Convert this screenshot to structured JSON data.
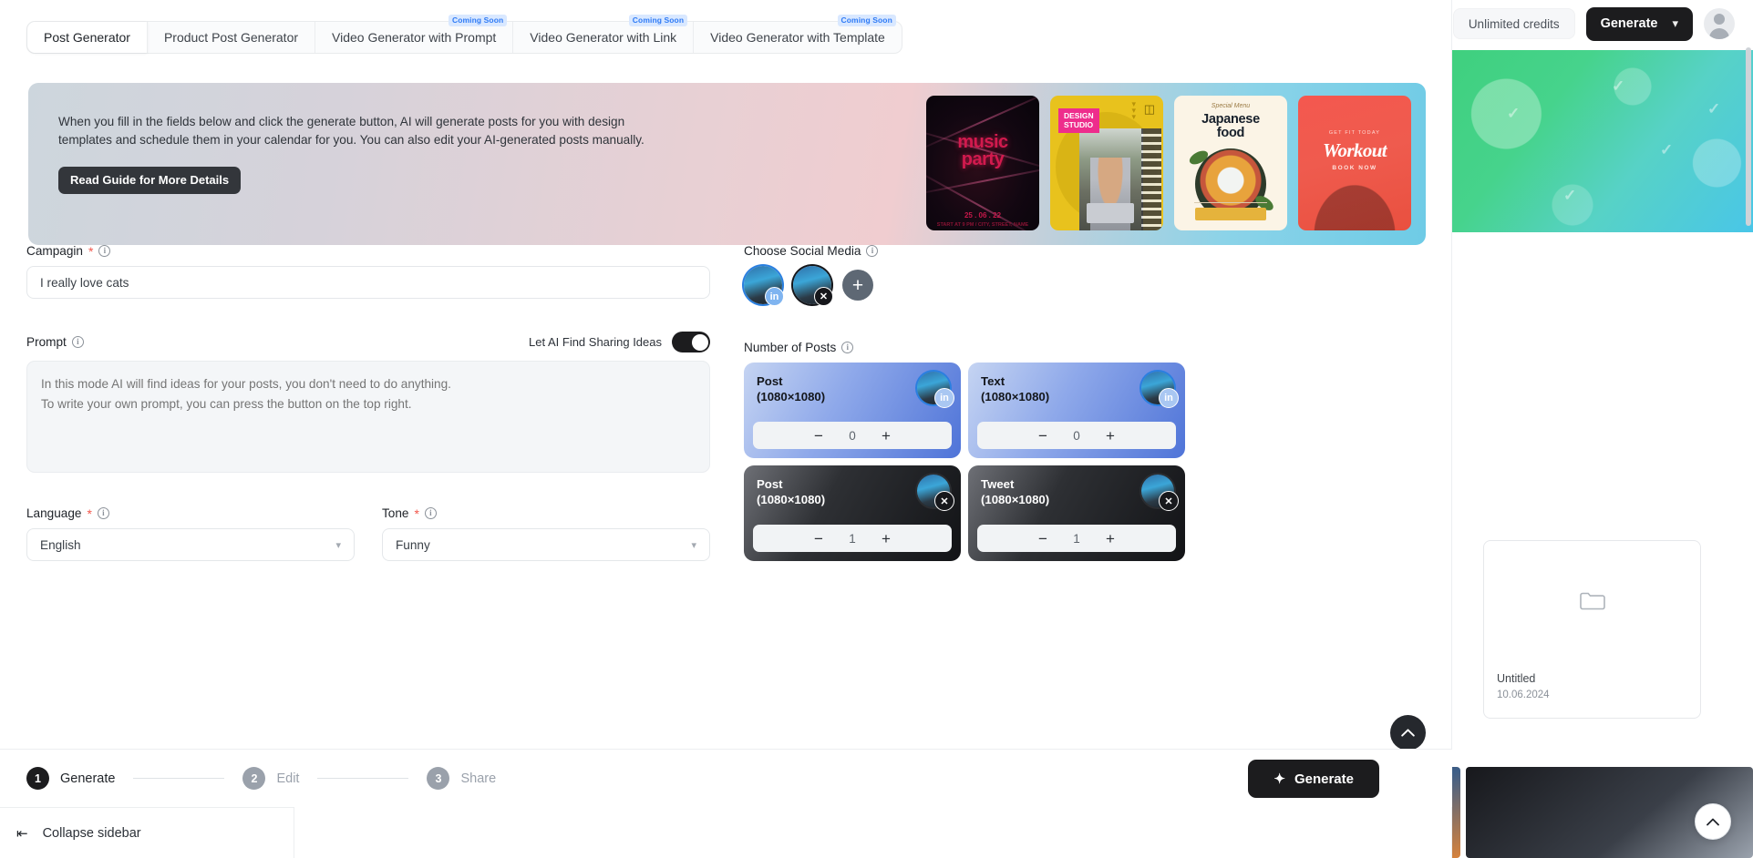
{
  "topbar": {
    "credits_label": "Unlimited credits",
    "generate_label": "Generate",
    "generate_chevron": "chevron-down-icon",
    "avatar": "user-avatar"
  },
  "tabs": [
    {
      "label": "Post Generator",
      "badge": "",
      "active": true
    },
    {
      "label": "Product Post Generator",
      "badge": "",
      "active": false
    },
    {
      "label": "Video Generator with Prompt",
      "badge": "Coming Soon",
      "active": false
    },
    {
      "label": "Video Generator with Link",
      "badge": "Coming Soon",
      "active": false
    },
    {
      "label": "Video Generator with Template",
      "badge": "Coming Soon",
      "active": false
    }
  ],
  "banner": {
    "line1": "When you fill in the fields below and click the generate button, AI will generate posts for you with design",
    "line2": "templates and schedule them in your calendar for you. You can also edit your AI-generated posts manually.",
    "button_label": "Read Guide for More Details",
    "thumbnails": [
      {
        "name": "music-party-template",
        "title": "music",
        "title2": "party",
        "date": "25 . 06 . 22",
        "sub": "START AT 9 PM / CITY, STREET, NAME"
      },
      {
        "name": "design-studio-template",
        "tag1": "DESIGN",
        "tag2": "STUDIO"
      },
      {
        "name": "japanese-food-template",
        "special": "Special Menu",
        "title": "Japanese",
        "title2": "food"
      },
      {
        "name": "workout-template",
        "small": "GET FIT TODAY",
        "title": "Workout",
        "cta": "BOOK NOW"
      }
    ]
  },
  "form": {
    "campaign": {
      "label": "Campagin",
      "required": "*",
      "info": "info-icon",
      "value": "I really love cats",
      "placeholder": "I really love cats"
    },
    "prompt": {
      "label": "Prompt",
      "info": "info-icon",
      "toggle_label": "Let AI Find Sharing Ideas",
      "toggle_on": true,
      "placeholder": "In this mode AI will find ideas for your posts, you don't need to do anything.\nTo write your own prompt, you can press the button on the top right.",
      "value": ""
    },
    "language": {
      "label": "Language",
      "required": "*",
      "info": "info-icon",
      "value": "English",
      "chevron": "chevron-down-icon"
    },
    "tone": {
      "label": "Tone",
      "required": "*",
      "info": "info-icon",
      "value": "Funny",
      "chevron": "chevron-down-icon"
    }
  },
  "social": {
    "label": "Choose Social Media",
    "info": "info-icon",
    "accounts": [
      {
        "network": "linkedin",
        "glyph": "in",
        "selected": true
      },
      {
        "network": "x-twitter",
        "glyph": "✕",
        "selected": false
      }
    ],
    "add_label": "+"
  },
  "posts": {
    "label": "Number of Posts",
    "info": "info-icon",
    "cards": [
      {
        "name": "Post",
        "size": "(1080×1080)",
        "value": "0",
        "network": "linkedin",
        "glyph": "in",
        "theme": "blue"
      },
      {
        "name": "Text",
        "size": "(1080×1080)",
        "value": "0",
        "network": "linkedin",
        "glyph": "in",
        "theme": "blue"
      },
      {
        "name": "Post",
        "size": "(1080×1080)",
        "value": "1",
        "network": "x-twitter",
        "glyph": "✕",
        "theme": "dark"
      },
      {
        "name": "Tweet",
        "size": "(1080×1080)",
        "value": "1",
        "network": "x-twitter",
        "glyph": "✕",
        "theme": "dark"
      }
    ],
    "minus": "−",
    "plus": "+"
  },
  "bottom": {
    "steps": [
      {
        "num": "1",
        "label": "Generate",
        "state": "active"
      },
      {
        "num": "2",
        "label": "Edit",
        "state": "idle"
      },
      {
        "num": "3",
        "label": "Share",
        "state": "idle"
      }
    ],
    "generate_label": "Generate",
    "generate_icon": "sparkle-icon",
    "scroll_top_icon": "chevron-up-icon"
  },
  "sidebar": {
    "collapse_label": "Collapse sidebar",
    "collapse_icon": "collapse-left-icon"
  },
  "background": {
    "card_title": "Untitled",
    "card_date": "10.06.2024",
    "folder_icon": "folder-icon",
    "scroll_top_icon": "chevron-up-icon"
  },
  "colors": {
    "accent_dark": "#1c1c1e",
    "required_red": "#f2574c",
    "badge_blue": "#2f7bf6",
    "badge_blue_bg": "#d9e8ff",
    "linkedin_blue": "#2a7fe0",
    "hero_green": "#3fd07e"
  }
}
